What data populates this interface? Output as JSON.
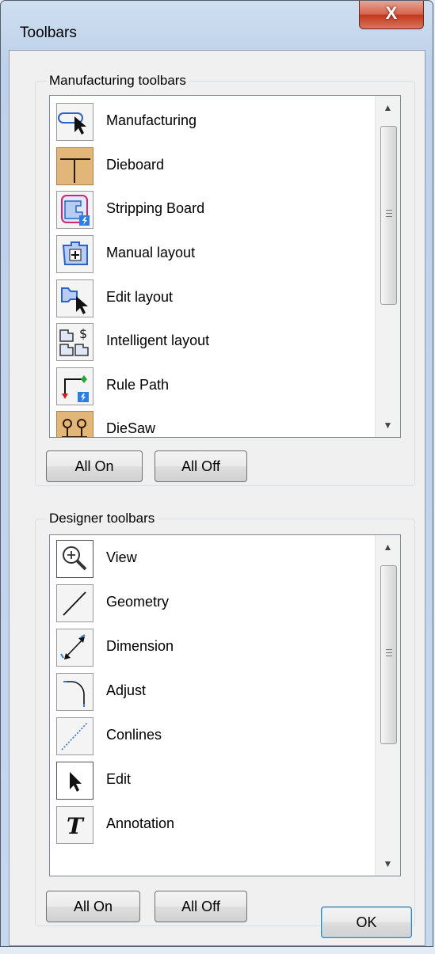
{
  "window": {
    "title": "Toolbars",
    "close_glyph": "X"
  },
  "manufacturing": {
    "group_label": "Manufacturing toolbars",
    "items": [
      {
        "label": "Manufacturing",
        "icon": "manufacturing-icon"
      },
      {
        "label": "Dieboard",
        "icon": "dieboard-icon"
      },
      {
        "label": "Stripping Board",
        "icon": "stripping-board-icon"
      },
      {
        "label": "Manual layout",
        "icon": "manual-layout-icon"
      },
      {
        "label": "Edit layout",
        "icon": "edit-layout-icon"
      },
      {
        "label": "Intelligent layout",
        "icon": "intelligent-layout-icon"
      },
      {
        "label": "Rule Path",
        "icon": "rule-path-icon"
      },
      {
        "label": "DieSaw",
        "icon": "diesaw-icon"
      }
    ],
    "all_on": "All On",
    "all_off": "All Off"
  },
  "designer": {
    "group_label": "Designer toolbars",
    "items": [
      {
        "label": "View",
        "icon": "view-zoom-icon"
      },
      {
        "label": "Geometry",
        "icon": "geometry-line-icon"
      },
      {
        "label": "Dimension",
        "icon": "dimension-icon"
      },
      {
        "label": "Adjust",
        "icon": "adjust-icon"
      },
      {
        "label": "Conlines",
        "icon": "conlines-icon"
      },
      {
        "label": "Edit",
        "icon": "edit-arrow-icon"
      },
      {
        "label": "Annotation",
        "icon": "annotation-icon"
      }
    ],
    "all_on": "All On",
    "all_off": "All Off"
  },
  "ok_label": "OK",
  "colors": {
    "close_button": "#c7432a",
    "list_border": "#828790",
    "dialog_bg": "#f0f0f0"
  }
}
